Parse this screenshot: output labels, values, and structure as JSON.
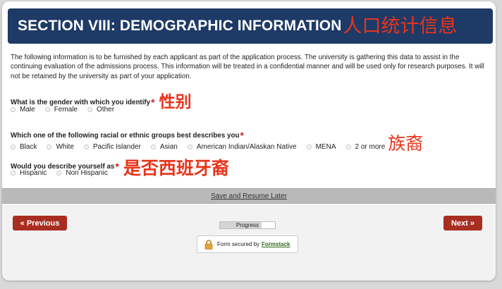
{
  "header": {
    "title": "SECTION VIII: DEMOGRAPHIC INFORMATION",
    "annotation": "人口统计信息"
  },
  "intro": "The following information is to be furnished by each applicant as part of the application process. The university is gathering this data to assist in the continuing evaluation of the admissions process. This information will be treated in a confidential manner and will be used only for research purposes. It will not be retained by the university as part of your application.",
  "questions": {
    "gender": {
      "label": "What is the gender with which you identify",
      "required": "*",
      "annotation": "性别",
      "options": [
        "Male",
        "Female",
        "Other"
      ]
    },
    "race": {
      "label": "Which one of the following racial or ethnic groups best describes you",
      "required": "*",
      "annotation": "族裔",
      "options": [
        "Black",
        "White",
        "Pacific Islander",
        "Asian",
        "American Indian/Alaskan Native",
        "MENA",
        "2 or more"
      ]
    },
    "hispanic": {
      "label": "Would you describe yourself as",
      "required": "*",
      "annotation": "是否西班牙裔",
      "options": [
        "Hispanic",
        "Non Hispanic"
      ]
    }
  },
  "save_bar": {
    "link": "Save and Resume Later"
  },
  "nav": {
    "previous": "« Previous",
    "next": "Next »",
    "progress_label": "Progress",
    "progress_fraction": 0.75
  },
  "secure": {
    "text": "Form secured by",
    "brand": "Formstack"
  },
  "colors": {
    "header_bg": "#1e3a66",
    "button_bg": "#a82e22",
    "annotation": "#e8341c",
    "required": "#d2232a"
  },
  "icons": {
    "lock": "lock-icon",
    "radio": "radio-circle"
  }
}
